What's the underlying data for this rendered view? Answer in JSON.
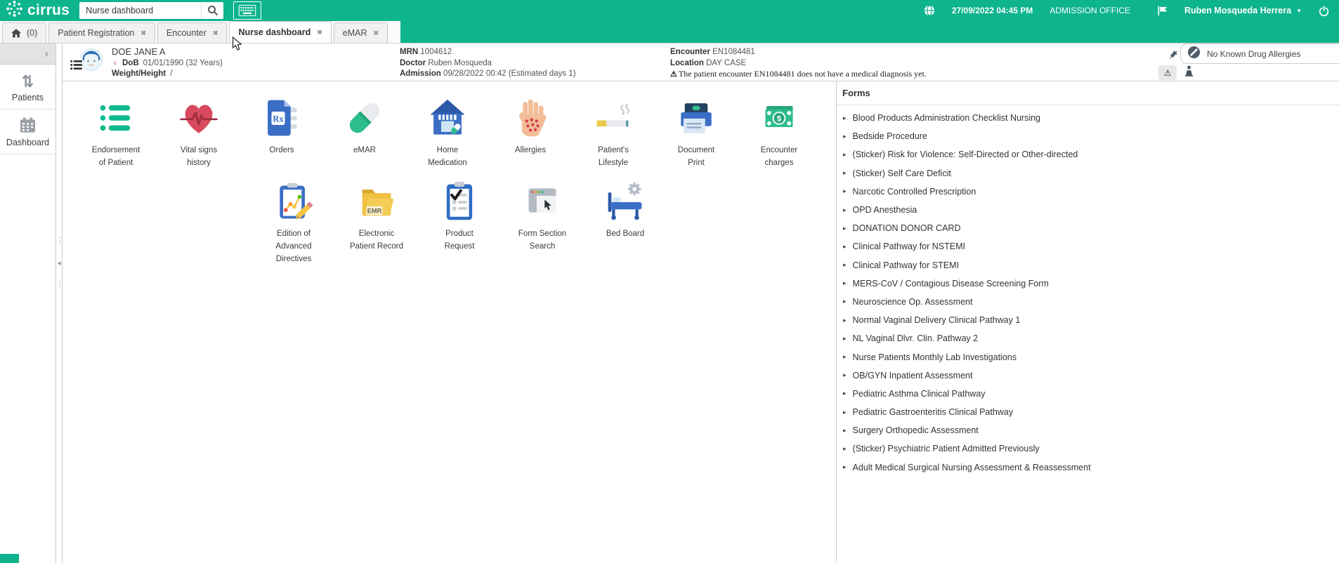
{
  "topbar": {
    "logo_text": "cirrus",
    "logo_icon": "cirrus-dots-icon",
    "search": {
      "value": "Nurse dashboard",
      "icon": "search-icon"
    },
    "keyboard_icon": "keyboard-icon",
    "globe_icon": "globe-icon",
    "datetime": "27/09/2022 04:45 PM",
    "office": "ADMISSION OFFICE",
    "flag_icon": "flag-icon",
    "user": "Ruben Mosqueda Herrera",
    "power_icon": "power-icon",
    "accent_color": "#0eb48e"
  },
  "tabs": [
    {
      "label": "(0)",
      "icon": "home-icon",
      "closable": false,
      "active": false
    },
    {
      "label": "Patient Registration",
      "closable": true,
      "active": false
    },
    {
      "label": "Encounter",
      "closable": true,
      "active": false
    },
    {
      "label": "Nurse dashboard",
      "closable": true,
      "active": true
    },
    {
      "label": "eMAR",
      "closable": true,
      "active": false
    }
  ],
  "patient_header": {
    "name": "DOE JANE A",
    "gender_icon": "female-icon",
    "gender_symbol": "♀",
    "dob": {
      "label": "DoB",
      "value": "01/01/1990 (32 Years)"
    },
    "weight_height": {
      "label": "Weight/Height",
      "value": "/"
    },
    "mrn": {
      "label": "MRN",
      "value": "1004612"
    },
    "doctor": {
      "label": "Doctor",
      "value": "Ruben Mosqueda"
    },
    "admission": {
      "label": "Admission",
      "value": "09/28/2022 00:42 (Estimated days 1)"
    },
    "encounter": {
      "label": "Encounter",
      "value": "EN1084481"
    },
    "location": {
      "label": "Location",
      "value": "DAY CASE"
    },
    "diagnosis_warning": "The patient encounter EN1084481 does not have a medical diagnosis yet.",
    "warning_symbol": "⚠",
    "allergy_status": "No Known Drug Allergies",
    "allergy_icon": "no-allergy-icon",
    "syringe_icon": "syringe-icon",
    "alert_button_icon": "warning-triangle-icon",
    "isolation_icon": "isolation-icon"
  },
  "sidebar": {
    "collapse_icon": "collapse-chevron-icon",
    "collapse_symbol": "‹",
    "items": [
      {
        "label": "Patients",
        "icon": "sort-arrows-icon"
      },
      {
        "label": "Dashboard",
        "icon": "dashboard-calendar-icon"
      }
    ]
  },
  "dashboard": {
    "rows": [
      [
        {
          "label": "Endorsement of Patient",
          "lines": [
            "Endorsement",
            "of Patient"
          ],
          "icon": "list-icon"
        },
        {
          "label": "Vital signs history",
          "lines": [
            "Vital signs",
            "history"
          ],
          "icon": "heart-pulse-icon"
        },
        {
          "label": "Orders",
          "lines": [
            "Orders"
          ],
          "icon": "rx-document-icon"
        },
        {
          "label": "eMAR",
          "lines": [
            "eMAR"
          ],
          "icon": "capsule-icon"
        },
        {
          "label": "Home Medication",
          "lines": [
            "Home",
            "Medication"
          ],
          "icon": "house-medication-icon"
        },
        {
          "label": "Allergies",
          "lines": [
            "Allergies"
          ],
          "icon": "allergy-hand-icon"
        },
        {
          "label": "Patient's Lifestyle",
          "lines": [
            "Patient's",
            "Lifestyle"
          ],
          "icon": "cigarette-icon"
        },
        {
          "label": "Document Print",
          "lines": [
            "Document",
            "Print"
          ],
          "icon": "printer-icon"
        },
        {
          "label": "Encounter charges",
          "lines": [
            "Encounter",
            "charges"
          ],
          "icon": "money-icon"
        }
      ],
      [
        {
          "label": "Edition of Advanced Directives",
          "lines": [
            "Edition of",
            "Advanced",
            "Directives"
          ],
          "icon": "clipboard-chart-icon"
        },
        {
          "label": "Electronic Patient Record",
          "lines": [
            "Electronic",
            "Patient Record"
          ],
          "icon": "emr-folder-icon"
        },
        {
          "label": "Product Request",
          "lines": [
            "Product",
            "Request"
          ],
          "icon": "clipboard-check-icon"
        },
        {
          "label": "Form Section Search",
          "lines": [
            "Form Section",
            "Search"
          ],
          "icon": "browser-cursor-icon"
        },
        {
          "label": "Bed Board",
          "lines": [
            "Bed Board"
          ],
          "icon": "bed-gear-icon"
        }
      ]
    ]
  },
  "forms_panel": {
    "title": "Forms",
    "item_arrow": "▸",
    "items": [
      "Blood Products Administration Checklist Nursing",
      "Bedside Procedure",
      "(Sticker) Risk for Violence: Self-Directed or Other-directed",
      "(Sticker) Self Care Deficit",
      "Narcotic Controlled Prescription",
      "OPD Anesthesia",
      "DONATION DONOR CARD",
      "Clinical Pathway for NSTEMI",
      "Clinical Pathway for STEMI",
      "MERS-CoV / Contagious Disease Screening Form",
      "Neuroscience Op. Assessment",
      "Normal Vaginal Delivery Clinical Pathway 1",
      "NL Vaginal Dlvr. Clin. Pathway 2",
      "Nurse Patients Monthly Lab Investigations",
      "OB/GYN Inpatient Assessment",
      "Pediatric Asthma Clinical Pathway",
      "Pediatric Gastroenteritis Clinical Pathway",
      "Surgery Orthopedic Assessment",
      "(Sticker) Psychiatric Patient Admitted Previously",
      "Adult Medical Surgical Nursing Assessment & Reassessment"
    ]
  }
}
